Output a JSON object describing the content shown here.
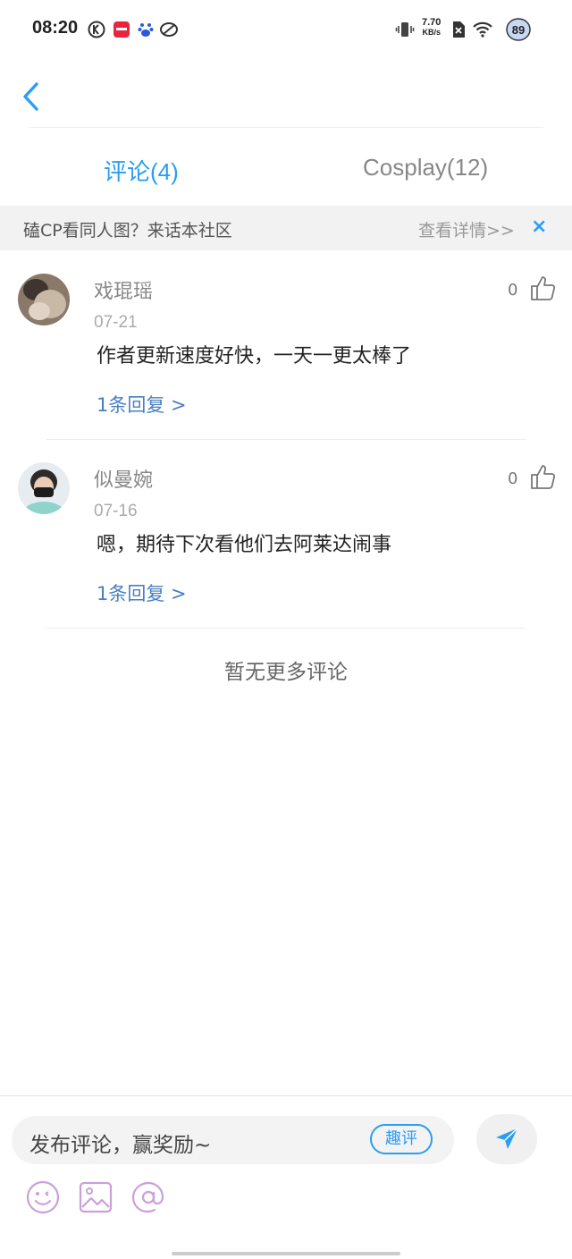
{
  "status_bar": {
    "time": "08:20",
    "net_speed": "7.70",
    "net_unit": "KB/s",
    "battery": "89"
  },
  "tabs": [
    {
      "label": "评论(4)",
      "active": true
    },
    {
      "label": "Cosplay(12)",
      "active": false
    }
  ],
  "banner": {
    "text": "磕CP看同人图？来话本社区",
    "link": "查看详情>>",
    "close": "×"
  },
  "comments": [
    {
      "user": "戏琨瑶",
      "date": "07-21",
      "text": "作者更新速度好快，一天一更太棒了",
      "replies": "1条回复 >",
      "likes": "0"
    },
    {
      "user": "似曼婉",
      "date": "07-16",
      "text": "嗯，期待下次看他们去阿莱达闹事",
      "replies": "1条回复 >",
      "likes": "0"
    }
  ],
  "no_more": "暂无更多评论",
  "compose": {
    "placeholder": "发布评论，赢奖励~",
    "fun_button": "趣评"
  },
  "colors": {
    "accent": "#2a9df4",
    "reply_link": "#4a7fc1",
    "tool_icon": "#c9a0dc"
  }
}
